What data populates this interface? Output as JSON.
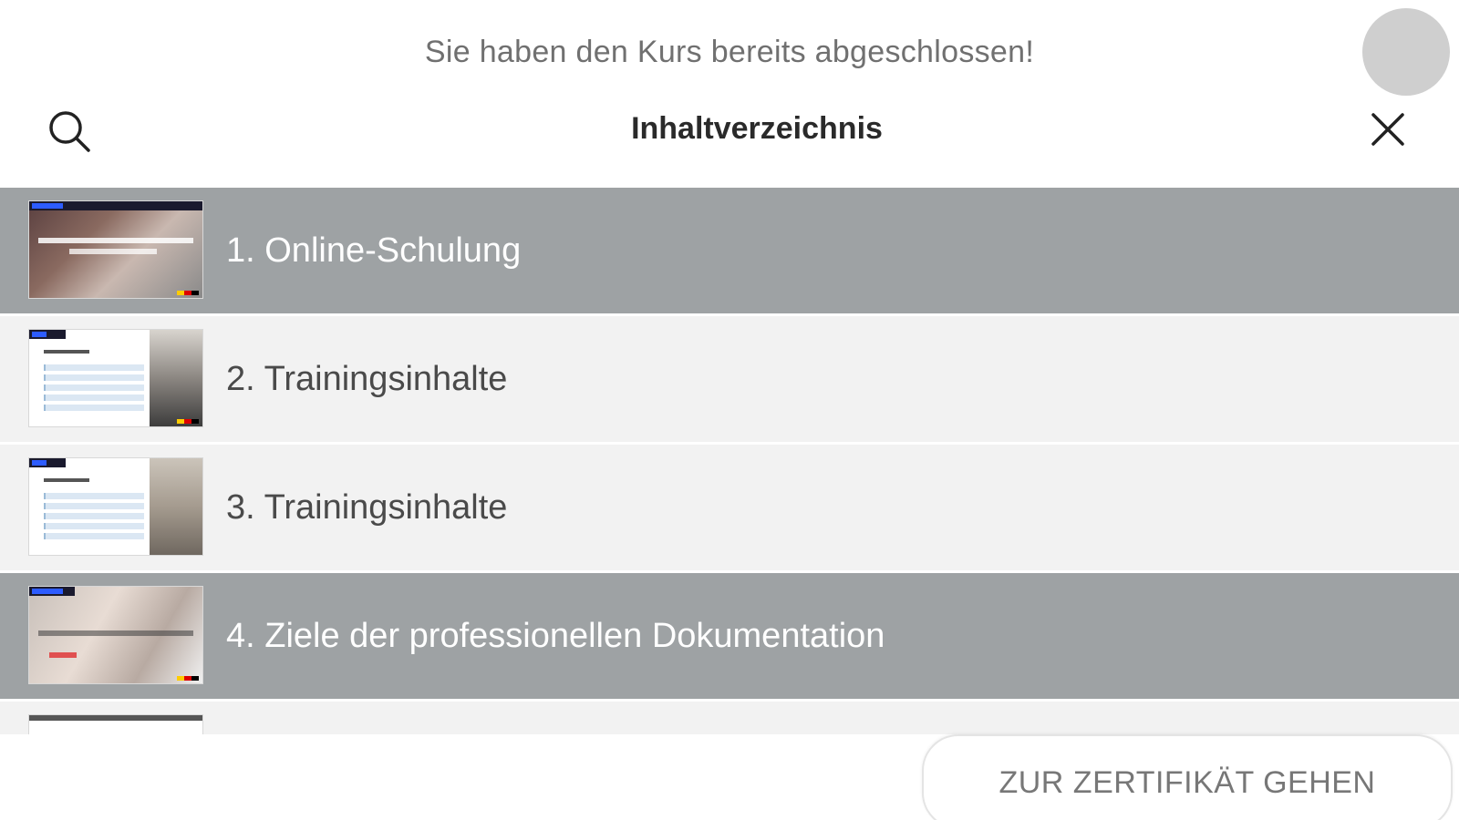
{
  "banner": {
    "message": "Sie haben den Kurs bereits abgeschlossen!"
  },
  "header": {
    "title": "Inhaltverzeichnis",
    "search_icon": "search-icon",
    "close_icon": "close-icon"
  },
  "chapters": [
    {
      "label": "1. Online-Schulung",
      "active": true
    },
    {
      "label": "2. Trainingsinhalte",
      "active": false
    },
    {
      "label": "3. Trainingsinhalte",
      "active": false
    },
    {
      "label": "4. Ziele der professionellen Dokumentation",
      "active": true
    }
  ],
  "footer": {
    "certificate_button": "ZUR ZERTIFIKÄT GEHEN"
  },
  "colors": {
    "active_row": "#9ea2a4",
    "inactive_row": "#f2f2f2",
    "text_dark": "#2a2a2a",
    "text_muted": "#707070"
  }
}
